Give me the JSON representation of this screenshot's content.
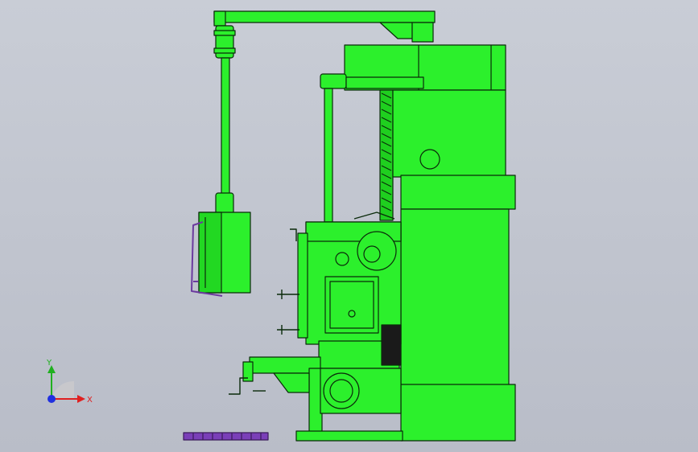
{
  "viewport": {
    "background_top": "#c9cdd6",
    "background_bottom": "#b9bdc8"
  },
  "model": {
    "body_color": "#2cf02c",
    "edge_color": "#0a2a0a",
    "accent_color": "#7a3fb8",
    "handle_color": "#6b3a9e"
  },
  "triad": {
    "x_label": "X",
    "y_label": "Y",
    "x_color": "#e02020",
    "y_color": "#20b020",
    "z_color": "#2030e0"
  }
}
